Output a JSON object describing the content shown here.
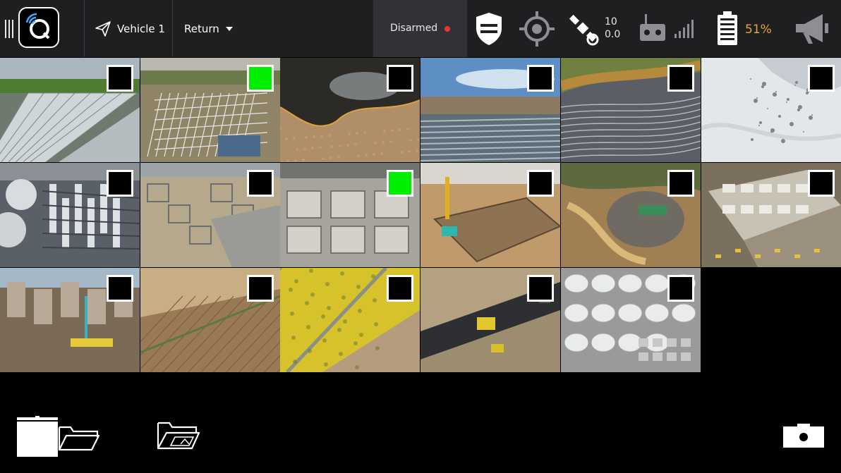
{
  "topbar": {
    "vehicle_label": "Vehicle 1",
    "mode_label": "Return",
    "arm_status": "Disarmed",
    "arm_status_color": "#e53935",
    "satellite_count": "10",
    "hdop": "0.0",
    "battery_percent": "51%",
    "battery_color": "#e8a33a",
    "icons": [
      "menu-grip-icon",
      "qgc-logo-icon",
      "paper-plane-icon",
      "chevron-down-icon",
      "shield-icon",
      "gps-crosshair-icon",
      "satellite-icon",
      "rc-remote-icon",
      "signal-bars-icon",
      "battery-icon",
      "megaphone-icon"
    ]
  },
  "gallery": {
    "selected_color": "#00ee00",
    "items": [
      {
        "scene": "greenhouses",
        "selected": false
      },
      {
        "scene": "power-substation",
        "selected": true
      },
      {
        "scene": "wildfire",
        "selected": false
      },
      {
        "scene": "tidal-flats",
        "selected": false
      },
      {
        "scene": "river-valley",
        "selected": false
      },
      {
        "scene": "snowy-mountain",
        "selected": false
      },
      {
        "scene": "industrial-plant",
        "selected": false
      },
      {
        "scene": "construction-foundation",
        "selected": false
      },
      {
        "scene": "concrete-foundations",
        "selected": true
      },
      {
        "scene": "excavation-site",
        "selected": false
      },
      {
        "scene": "earthworks-pit",
        "selected": false
      },
      {
        "scene": "building-frame",
        "selected": false
      },
      {
        "scene": "city-construction",
        "selected": false
      },
      {
        "scene": "plowed-field",
        "selected": false
      },
      {
        "scene": "rapeseed-field",
        "selected": false
      },
      {
        "scene": "road-paving",
        "selected": false
      },
      {
        "scene": "storage-tanks",
        "selected": false
      }
    ]
  },
  "bottombar": {
    "icons": [
      "delete-folder-icon",
      "open-folder-icon",
      "photo-folder-icon",
      "camera-icon"
    ]
  }
}
